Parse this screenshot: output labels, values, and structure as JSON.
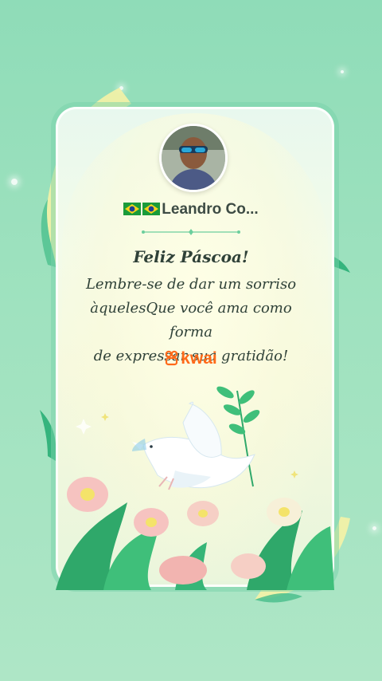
{
  "profile": {
    "username": "Leandro Co...",
    "flags": [
      "brazil-flag-icon",
      "brazil-flag-icon"
    ]
  },
  "greeting": {
    "title": "Feliz Páscoa!",
    "line1": "Lembre-se de dar um sorriso",
    "line2": "àquelesQue você ama como forma",
    "line3": "de expressar sua gratidão!"
  },
  "brand": {
    "name": "kwai",
    "icon": "kwai-logo-icon",
    "color": "#ff6a1a"
  },
  "colors": {
    "background": "#9fe2bf",
    "card": "#f3fbe9",
    "ribbon": "#f4f0a0",
    "leaf": "#3fbf7a"
  }
}
